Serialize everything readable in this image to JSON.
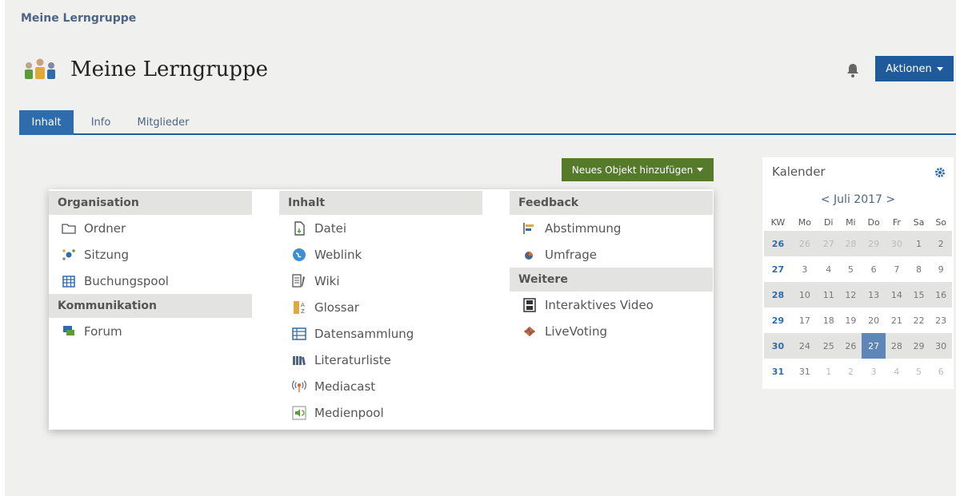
{
  "breadcrumb": "Meine Lerngruppe",
  "title": "Meine Lerngruppe",
  "header": {
    "aktionen_label": "Aktionen"
  },
  "tabs": [
    {
      "label": "Inhalt",
      "active": true
    },
    {
      "label": "Info",
      "active": false
    },
    {
      "label": "Mitglieder",
      "active": false
    }
  ],
  "add_button_label": "Neues Objekt hinzufügen",
  "dropdown": {
    "columns": [
      {
        "sections": [
          {
            "heading": "Organisation",
            "items": [
              "Ordner",
              "Sitzung",
              "Buchungspool"
            ]
          },
          {
            "heading": "Kommunikation",
            "items": [
              "Forum"
            ]
          }
        ]
      },
      {
        "sections": [
          {
            "heading": "Inhalt",
            "items": [
              "Datei",
              "Weblink",
              "Wiki",
              "Glossar",
              "Datensammlung",
              "Literaturliste",
              "Mediacast",
              "Medienpool"
            ]
          }
        ]
      },
      {
        "sections": [
          {
            "heading": "Feedback",
            "items": [
              "Abstimmung",
              "Umfrage"
            ]
          },
          {
            "heading": "Weitere",
            "items": [
              "Interaktives Video",
              "LiveVoting"
            ]
          }
        ]
      }
    ]
  },
  "calendar": {
    "title": "Kalender",
    "month_label": "< Juli 2017 >",
    "weekdays": [
      "KW",
      "Mo",
      "Di",
      "Mi",
      "Do",
      "Fr",
      "Sa",
      "So"
    ],
    "weeks": [
      {
        "kw": "26",
        "days": [
          "26",
          "27",
          "28",
          "29",
          "30",
          "1",
          "2"
        ]
      },
      {
        "kw": "27",
        "days": [
          "3",
          "4",
          "5",
          "6",
          "7",
          "8",
          "9"
        ]
      },
      {
        "kw": "28",
        "days": [
          "10",
          "11",
          "12",
          "13",
          "14",
          "15",
          "16"
        ]
      },
      {
        "kw": "29",
        "days": [
          "17",
          "18",
          "19",
          "20",
          "21",
          "22",
          "23"
        ]
      },
      {
        "kw": "30",
        "days": [
          "24",
          "25",
          "26",
          "27",
          "28",
          "29",
          "30"
        ]
      },
      {
        "kw": "31",
        "days": [
          "31",
          "1",
          "2",
          "3",
          "4",
          "5",
          "6"
        ]
      }
    ],
    "today": "27"
  },
  "colors": {
    "primary": "#1f5b9a",
    "accent_green": "#557a2a",
    "link": "#4c6586"
  }
}
